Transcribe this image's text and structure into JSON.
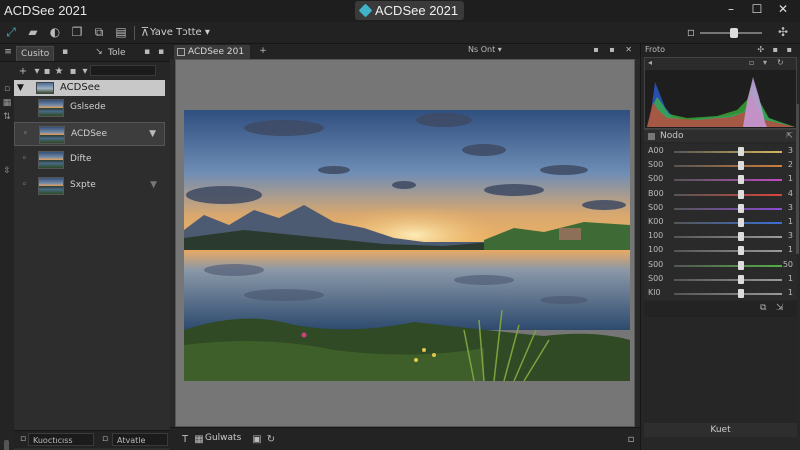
{
  "window": {
    "app_name": "ACDSee 2021",
    "title": "ACDSee 2021",
    "controls": {
      "minimize": "–",
      "maximize": "☐",
      "close": "✕"
    }
  },
  "toolbar": {
    "workspace_label": "Yave Tɔtte",
    "workspace_arrow": "▾",
    "zoom_icon": "✣"
  },
  "left_panel": {
    "tabs": [
      {
        "label": "Cusito"
      },
      {
        "label": "Tole"
      }
    ],
    "folder": {
      "label": "ACDSee"
    },
    "items": [
      {
        "label": "Gslsede",
        "selected": false,
        "arrow": ""
      },
      {
        "label": "ACDSee",
        "selected": true,
        "arrow": "▼"
      },
      {
        "label": "Difte",
        "selected": false,
        "arrow": ""
      },
      {
        "label": "Sxpte",
        "selected": false,
        "arrow": "▼"
      }
    ],
    "bottom": {
      "left_field": "Kuoctıcıss",
      "right_field": "Atvatle"
    }
  },
  "center": {
    "doc_tab": "ACDSee 201",
    "title": "Ns Ont",
    "title_arrow": "▾",
    "bottom_label": "Gulwats"
  },
  "right_panel": {
    "tab_label": "Froto",
    "section_label": "Nodo",
    "sliders": [
      {
        "label": "A00",
        "value": "3",
        "fraction": 0.62,
        "color": "#d3b85a"
      },
      {
        "label": "S00",
        "value": "2",
        "fraction": 0.62,
        "color": "#cf7f3a"
      },
      {
        "label": "S00",
        "value": "1",
        "fraction": 0.62,
        "color": "#c04bc2"
      },
      {
        "label": "B00",
        "value": "4",
        "fraction": 0.62,
        "color": "#d9453c"
      },
      {
        "label": "S00",
        "value": "3",
        "fraction": 0.62,
        "color": "#8b4bd2"
      },
      {
        "label": "K00",
        "value": "1",
        "fraction": 0.62,
        "color": "#3b6ed3"
      },
      {
        "label": "100",
        "value": "3",
        "fraction": 0.62,
        "color": "#9a9a9a"
      },
      {
        "label": "100",
        "value": "1",
        "fraction": 0.62,
        "color": "#9a9a9a"
      },
      {
        "label": "S00",
        "value": "50",
        "fraction": 0.62,
        "color": "#54b046"
      },
      {
        "label": "S00",
        "value": "1",
        "fraction": 0.62,
        "color": "#9a9a9a"
      },
      {
        "label": "Kl0",
        "value": "1",
        "fraction": 0.62,
        "color": "#9a9a9a"
      }
    ],
    "bottom_label": "Kuet"
  }
}
